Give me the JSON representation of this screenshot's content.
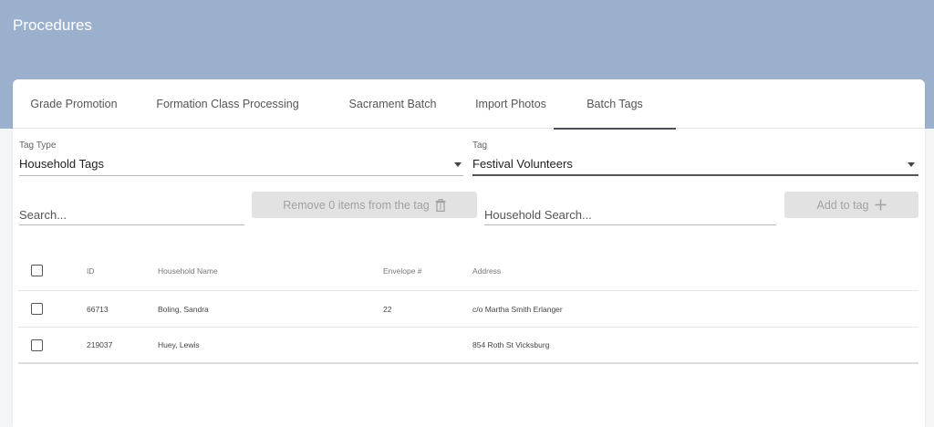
{
  "page": {
    "title": "Procedures"
  },
  "tabs": [
    {
      "label": "Grade Promotion"
    },
    {
      "label": "Formation Class Processing"
    },
    {
      "label": "Sacrament Batch"
    },
    {
      "label": "Import Photos"
    },
    {
      "label": "Batch Tags"
    }
  ],
  "filters": {
    "tag_type": {
      "label": "Tag Type",
      "value": "Household Tags"
    },
    "tag": {
      "label": "Tag",
      "value": "Festival Volunteers"
    }
  },
  "search": {
    "placeholder": "Search..."
  },
  "remove_button": {
    "label": "Remove 0 items from the tag"
  },
  "household_search": {
    "placeholder": "Household Search..."
  },
  "add_button": {
    "label": "Add to tag"
  },
  "table": {
    "columns": [
      "ID",
      "Household Name",
      "Envelope #",
      "Address"
    ],
    "rows": [
      {
        "id": "66713",
        "name": "Boling, Sandra",
        "envelope": "22",
        "address": "c/o Martha Smith Erlanger"
      },
      {
        "id": "219037",
        "name": "Huey, Lewis",
        "envelope": "",
        "address": "854 Roth St Vicksburg"
      }
    ]
  },
  "colors": {
    "banner": "#9ab0cc",
    "card": "#ffffff",
    "active_tab_indicator": "#4a4f57",
    "disabled_button": "#e2e2e2"
  }
}
